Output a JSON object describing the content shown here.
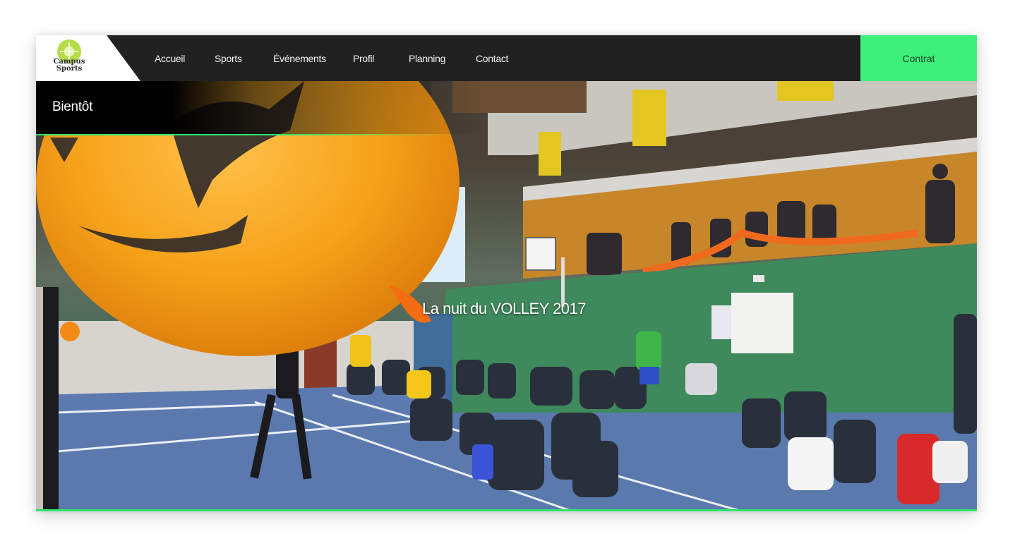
{
  "brand": {
    "logo_text_line1": "Campus",
    "logo_text_line2": "Sports",
    "logo_icon": "lime-slice-icon"
  },
  "nav": {
    "items": [
      {
        "label": "Accueil"
      },
      {
        "label": "Sports"
      },
      {
        "label": "Événements"
      },
      {
        "label": "Profil"
      },
      {
        "label": "Planning"
      },
      {
        "label": "Contact"
      }
    ],
    "cta_label": "Contrat"
  },
  "hero": {
    "section_label": "Bientôt",
    "title": "La nuit du VOLLEY 2017"
  },
  "colors": {
    "accent": "#3df07a",
    "navbar": "#212121",
    "balloon": "#f6a21a"
  }
}
